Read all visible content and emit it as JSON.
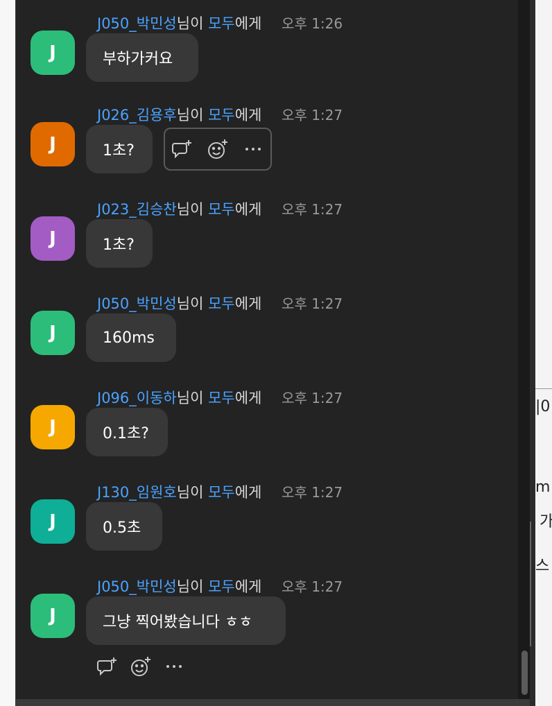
{
  "chat": {
    "messages": [
      {
        "sender": "J050_박민성",
        "suffix1": "님이",
        "target": "모두",
        "suffix2": "에게",
        "time": "오후 1:26",
        "avatar_letter": "J",
        "avatar_color": "#2dbd7a",
        "text": "부하가커요"
      },
      {
        "sender": "J026_김용후",
        "suffix1": "님이",
        "target": "모두",
        "suffix2": "에게",
        "time": "오후 1:27",
        "avatar_letter": "J",
        "avatar_color": "#e06a00",
        "text": "1초?"
      },
      {
        "sender": "J023_김승찬",
        "suffix1": "님이",
        "target": "모두",
        "suffix2": "에게",
        "time": "오후 1:27",
        "avatar_letter": "J",
        "avatar_color": "#a35cc4",
        "text": "1초?"
      },
      {
        "sender": "J050_박민성",
        "suffix1": "님이",
        "target": "모두",
        "suffix2": "에게",
        "time": "오후 1:27",
        "avatar_letter": "J",
        "avatar_color": "#2dbd7a",
        "text": "160ms"
      },
      {
        "sender": "J096_이동하",
        "suffix1": "님이",
        "target": "모두",
        "suffix2": "에게",
        "time": "오후 1:27",
        "avatar_letter": "J",
        "avatar_color": "#f6a800",
        "text": "0.1초?"
      },
      {
        "sender": "J130_임원호",
        "suffix1": "님이",
        "target": "모두",
        "suffix2": "에게",
        "time": "오후 1:27",
        "avatar_letter": "J",
        "avatar_color": "#0fae96",
        "text": "0.5초"
      },
      {
        "sender": "J050_박민성",
        "suffix1": "님이",
        "target": "모두",
        "suffix2": "에게",
        "time": "오후 1:27",
        "avatar_letter": "J",
        "avatar_color": "#2dbd7a",
        "text": "그냥 찍어봤습니다 ㅎㅎ"
      }
    ]
  },
  "actions": {
    "icons": [
      "reply-add-icon",
      "emoji-add-icon",
      "more-icon"
    ]
  },
  "right_panel": {
    "fragments": [
      "|0",
      "m",
      "가",
      "스"
    ]
  }
}
